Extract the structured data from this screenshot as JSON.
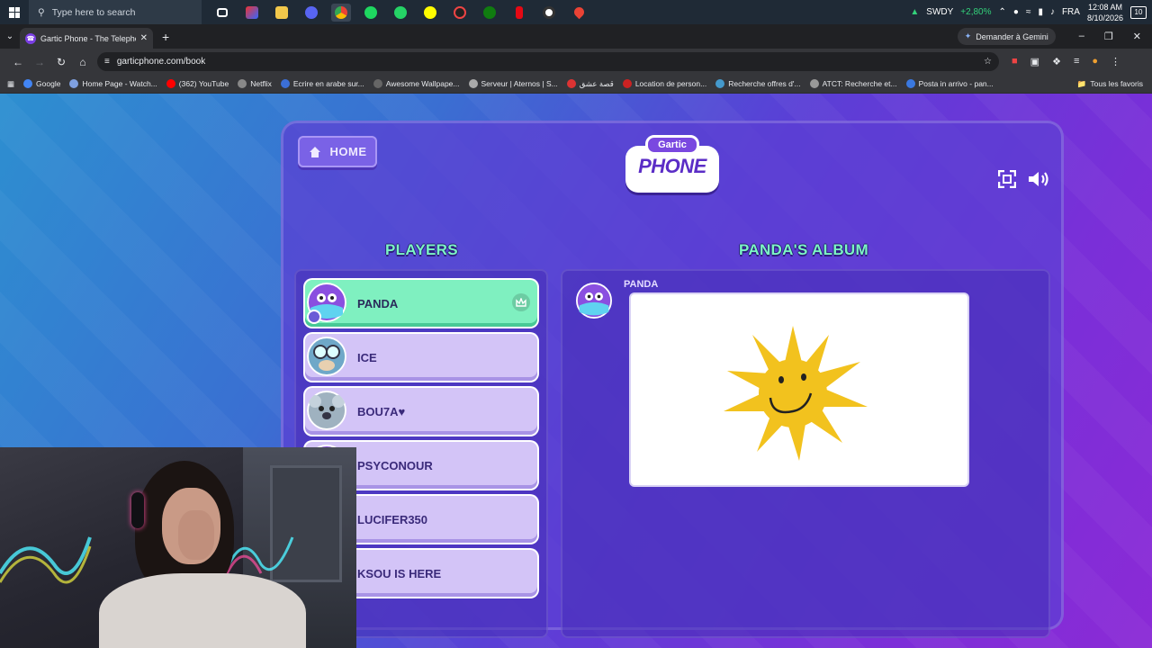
{
  "taskbar": {
    "search_placeholder": "Type here to search",
    "apps": [
      "task-view",
      "app-red",
      "file-explorer",
      "discord",
      "chrome",
      "spotify",
      "whatsapp",
      "snapchat",
      "app-dark",
      "xbox",
      "netflix",
      "obs",
      "maps"
    ],
    "stock": {
      "name": "SWDY",
      "change": "+2,80%"
    },
    "language": "FRA",
    "time": "12:08 AM",
    "date": "8/10/2026",
    "notifications": "10"
  },
  "browser": {
    "tab_title": "Gartic Phone - The Telephone G",
    "gemini_label": "Demander à Gemini",
    "url": "garticphone.com/book",
    "bookmarks": [
      "Google",
      "Home Page - Watch...",
      "(362) YouTube",
      "Netflix",
      "Ecrire en arabe sur...",
      "Awesome Wallpape...",
      "Serveur | Aternos | S...",
      "قصة عشق",
      "Location de person...",
      "Recherche offres d'...",
      "ATCT: Recherche et...",
      "Posta in arrivo - pan..."
    ],
    "all_bookmarks": "Tous les favoris"
  },
  "game": {
    "home_label": "HOME",
    "logo_top": "Gartic",
    "logo_main": "PHONE",
    "players_title": "PLAYERS",
    "album_title": "PANDA'S ALBUM",
    "players": [
      {
        "name": "PANDA",
        "host": true
      },
      {
        "name": "ICE",
        "host": false
      },
      {
        "name": "BOU7A♥",
        "host": false
      },
      {
        "name": "PSYCONOUR",
        "host": false
      },
      {
        "name": "LUCIFER350",
        "host": false
      },
      {
        "name": "KSOU IS HERE",
        "host": false
      }
    ],
    "album_author": "PANDA",
    "colors": {
      "host_row": "#7ff0c0",
      "player_row": "#d3c4f7",
      "title": "#7cf5c4"
    }
  }
}
